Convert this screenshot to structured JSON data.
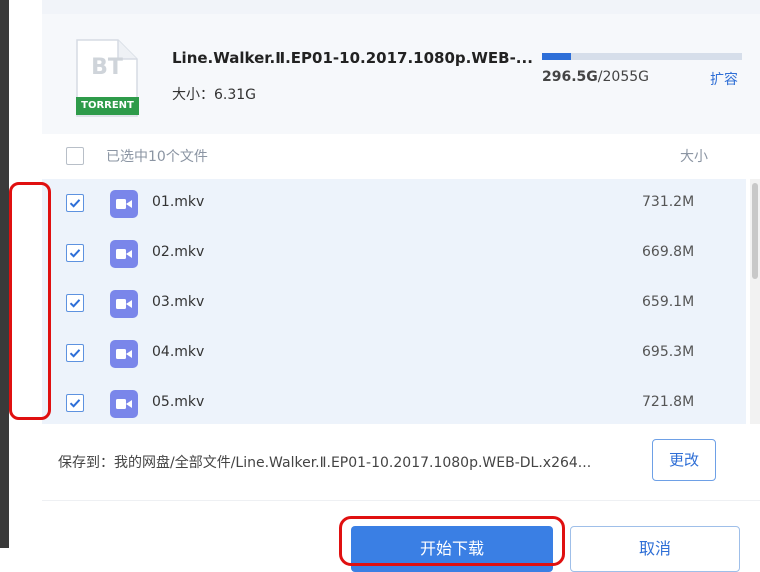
{
  "file": {
    "icon_text": "BT",
    "icon_badge": "TORRENT",
    "title": "Line.Walker.Ⅱ.EP01-10.2017.1080p.WEB-...",
    "size_label": "大小：6.31G"
  },
  "storage": {
    "used": "296.5G",
    "total": "/2055G",
    "used_fraction": 0.144,
    "expand_label": "扩容",
    "bar_color": "#2e6fd8"
  },
  "list": {
    "selected_label": "已选中10个文件",
    "size_header": "大小",
    "items": [
      {
        "name": "01.mkv",
        "size": "731.2M",
        "checked": true
      },
      {
        "name": "02.mkv",
        "size": "669.8M",
        "checked": true
      },
      {
        "name": "03.mkv",
        "size": "659.1M",
        "checked": true
      },
      {
        "name": "04.mkv",
        "size": "695.3M",
        "checked": true
      },
      {
        "name": "05.mkv",
        "size": "721.8M",
        "checked": true
      }
    ]
  },
  "save": {
    "path_label": "保存到：我的网盘/全部文件/Line.Walker.Ⅱ.EP01-10.2017.1080p.WEB-DL.x264...",
    "change_label": "更改"
  },
  "actions": {
    "start_label": "开始下载",
    "cancel_label": "取消"
  },
  "icons": {
    "checkbox": "checkmark-icon",
    "file_type": "video-file-icon",
    "torrent": "bt-torrent-icon"
  },
  "colors": {
    "accent": "#3a7fe4",
    "highlight": "#e01010",
    "video_icon": "#7a86ea",
    "torrent_badge": "#2e9b4a"
  }
}
